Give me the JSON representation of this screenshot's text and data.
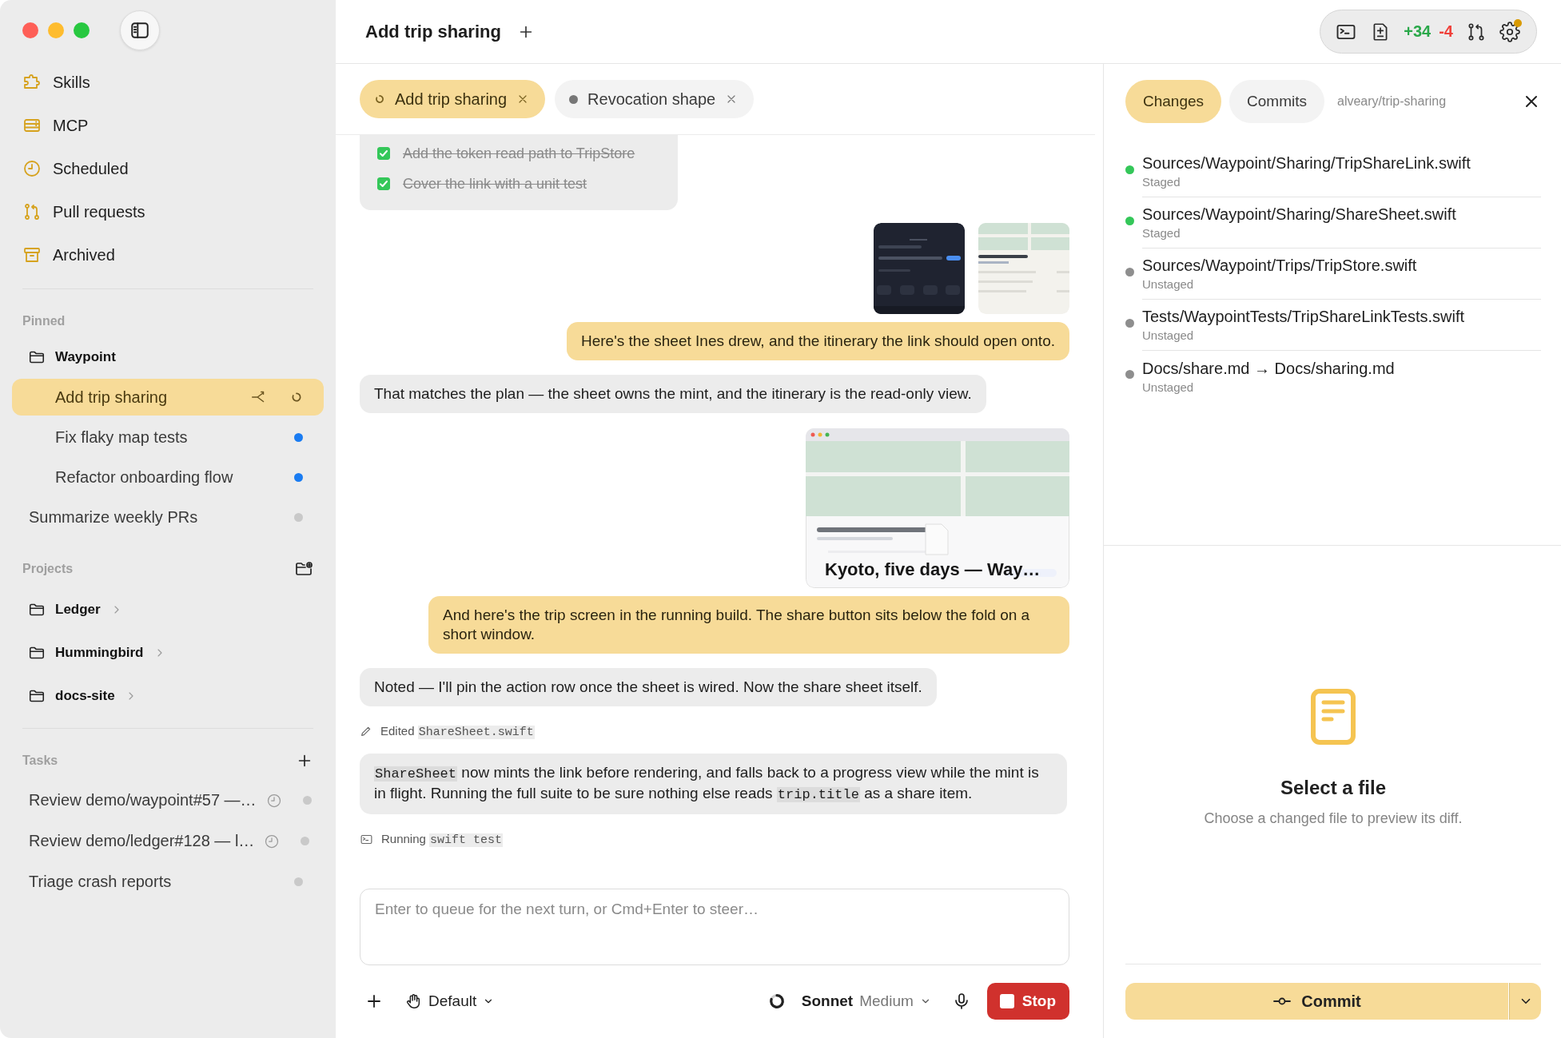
{
  "sidebar": {
    "nav": [
      {
        "label": "Skills"
      },
      {
        "label": "MCP"
      },
      {
        "label": "Scheduled"
      },
      {
        "label": "Pull requests"
      },
      {
        "label": "Archived"
      }
    ],
    "pinned": {
      "heading": "Pinned",
      "items": [
        {
          "kind": "folder",
          "label": "Waypoint",
          "children": [
            {
              "kind": "running",
              "label": "Add trip sharing",
              "selected": true
            },
            {
              "kind": "dotted",
              "label": "Fix flaky map tests",
              "selected": false,
              "color": "#1a7cf2"
            },
            {
              "kind": "dotted",
              "label": "Refactor onboarding flow",
              "selected": false,
              "color": "#1a7cf2"
            }
          ]
        },
        {
          "kind": "dotted",
          "label": "Summarize weekly PRs",
          "selected": false,
          "color": "#c9c9c9"
        }
      ]
    },
    "projects": {
      "heading": "Projects",
      "items": [
        {
          "label": "Ledger",
          "expanded": false
        },
        {
          "label": "Hummingbird",
          "expanded": false
        },
        {
          "label": "docs-site",
          "expanded": false
        }
      ]
    },
    "tasks": {
      "heading": "Tasks",
      "items": [
        {
          "label": "Review demo/waypoint#57 —…",
          "scheduled": true,
          "color": "#c9c9c9"
        },
        {
          "label": "Review demo/ledger#128 — l…",
          "scheduled": true,
          "color": "#c9c9c9"
        },
        {
          "label": "Triage crash reports",
          "scheduled": false,
          "color": "#c9c9c9"
        }
      ]
    }
  },
  "header": {
    "title": "Add trip sharing"
  },
  "toolbar": {
    "additions": "+34",
    "deletions": "-4",
    "settings_badge": true
  },
  "chat": {
    "tabs": [
      {
        "label": "Add trip sharing",
        "selected": true,
        "kind": "running"
      },
      {
        "label": "Revocation shape",
        "selected": false,
        "kind": "idle"
      }
    ],
    "messages": [
      {
        "kind": "checklist",
        "items": [
          {
            "text": "Add the token read path to TripStore",
            "checked": true
          },
          {
            "text": "Cover the link with a unit test",
            "checked": true
          }
        ]
      },
      {
        "kind": "attachments"
      },
      {
        "kind": "user",
        "text": "Here's the sheet Ines drew, and the itinerary the link should open onto."
      },
      {
        "kind": "assistant",
        "parts": [
          {
            "text": "That matches the plan — the sheet owns the mint, and the itinerary is the read-only view."
          }
        ]
      },
      {
        "kind": "screenshot",
        "caption": "Kyoto, five days — Way…"
      },
      {
        "kind": "user",
        "text": "And here's the trip screen in the running build. The share button sits below the fold on a short window."
      },
      {
        "kind": "assistant",
        "parts": [
          {
            "text": "Noted — I'll pin the action row once the sheet is wired. Now the share sheet itself."
          }
        ]
      },
      {
        "kind": "edit_activity",
        "label": "Edited",
        "code": "ShareSheet.swift"
      },
      {
        "kind": "assistant",
        "parts": [
          {
            "text": "ShareSheet",
            "code": true
          },
          {
            "text": " now mints the link before rendering, and falls back to a progress view while the mint is in flight. Running the full suite to be sure nothing else reads "
          },
          {
            "text": "trip.title",
            "code": true
          },
          {
            "text": " as a share item."
          }
        ]
      },
      {
        "kind": "run_activity",
        "label": "Running",
        "code": "swift test"
      }
    ],
    "composer": {
      "placeholder": "Enter to queue for the next turn, or Cmd+Enter to steer…",
      "mode": "Default",
      "model": "Sonnet",
      "effort": "Medium",
      "stop": "Stop"
    }
  },
  "review": {
    "tabs": [
      {
        "label": "Changes",
        "selected": true
      },
      {
        "label": "Commits",
        "selected": false
      }
    ],
    "branch": "alveary/trip-sharing",
    "files": [
      {
        "path": "Sources/Waypoint/Sharing/TripShareLink.swift",
        "status": "Staged",
        "color": "#34c759"
      },
      {
        "path": "Sources/Waypoint/Sharing/ShareSheet.swift",
        "status": "Staged",
        "color": "#34c759"
      },
      {
        "path": "Sources/Waypoint/Trips/TripStore.swift",
        "status": "Unstaged",
        "color": "#8e8e8e"
      },
      {
        "path": "Tests/WaypointTests/TripShareLinkTests.swift",
        "status": "Unstaged",
        "color": "#8e8e8e"
      },
      {
        "path": "Docs/share.md → Docs/sharing.md",
        "status": "Unstaged",
        "color": "#8e8e8e"
      }
    ],
    "empty": {
      "title": "Select a file",
      "text": "Choose a changed file to preview its diff."
    },
    "commit": "Commit"
  }
}
